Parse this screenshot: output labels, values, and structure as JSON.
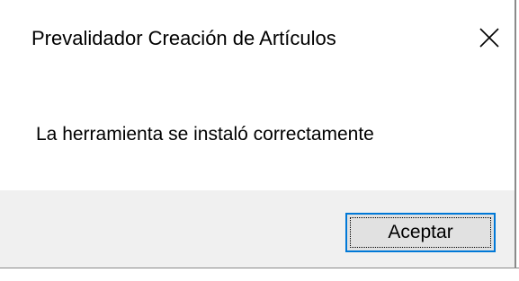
{
  "dialog": {
    "title": "Prevalidador Creación de Artículos",
    "message": "La herramienta se instaló correctamente",
    "close_icon": "close-icon",
    "ok_label": "Aceptar"
  },
  "colors": {
    "content_bg": "#ffffff",
    "footer_bg": "#f0f0f0",
    "button_bg": "#e1e1e1",
    "button_focus_border": "#0078d7"
  }
}
